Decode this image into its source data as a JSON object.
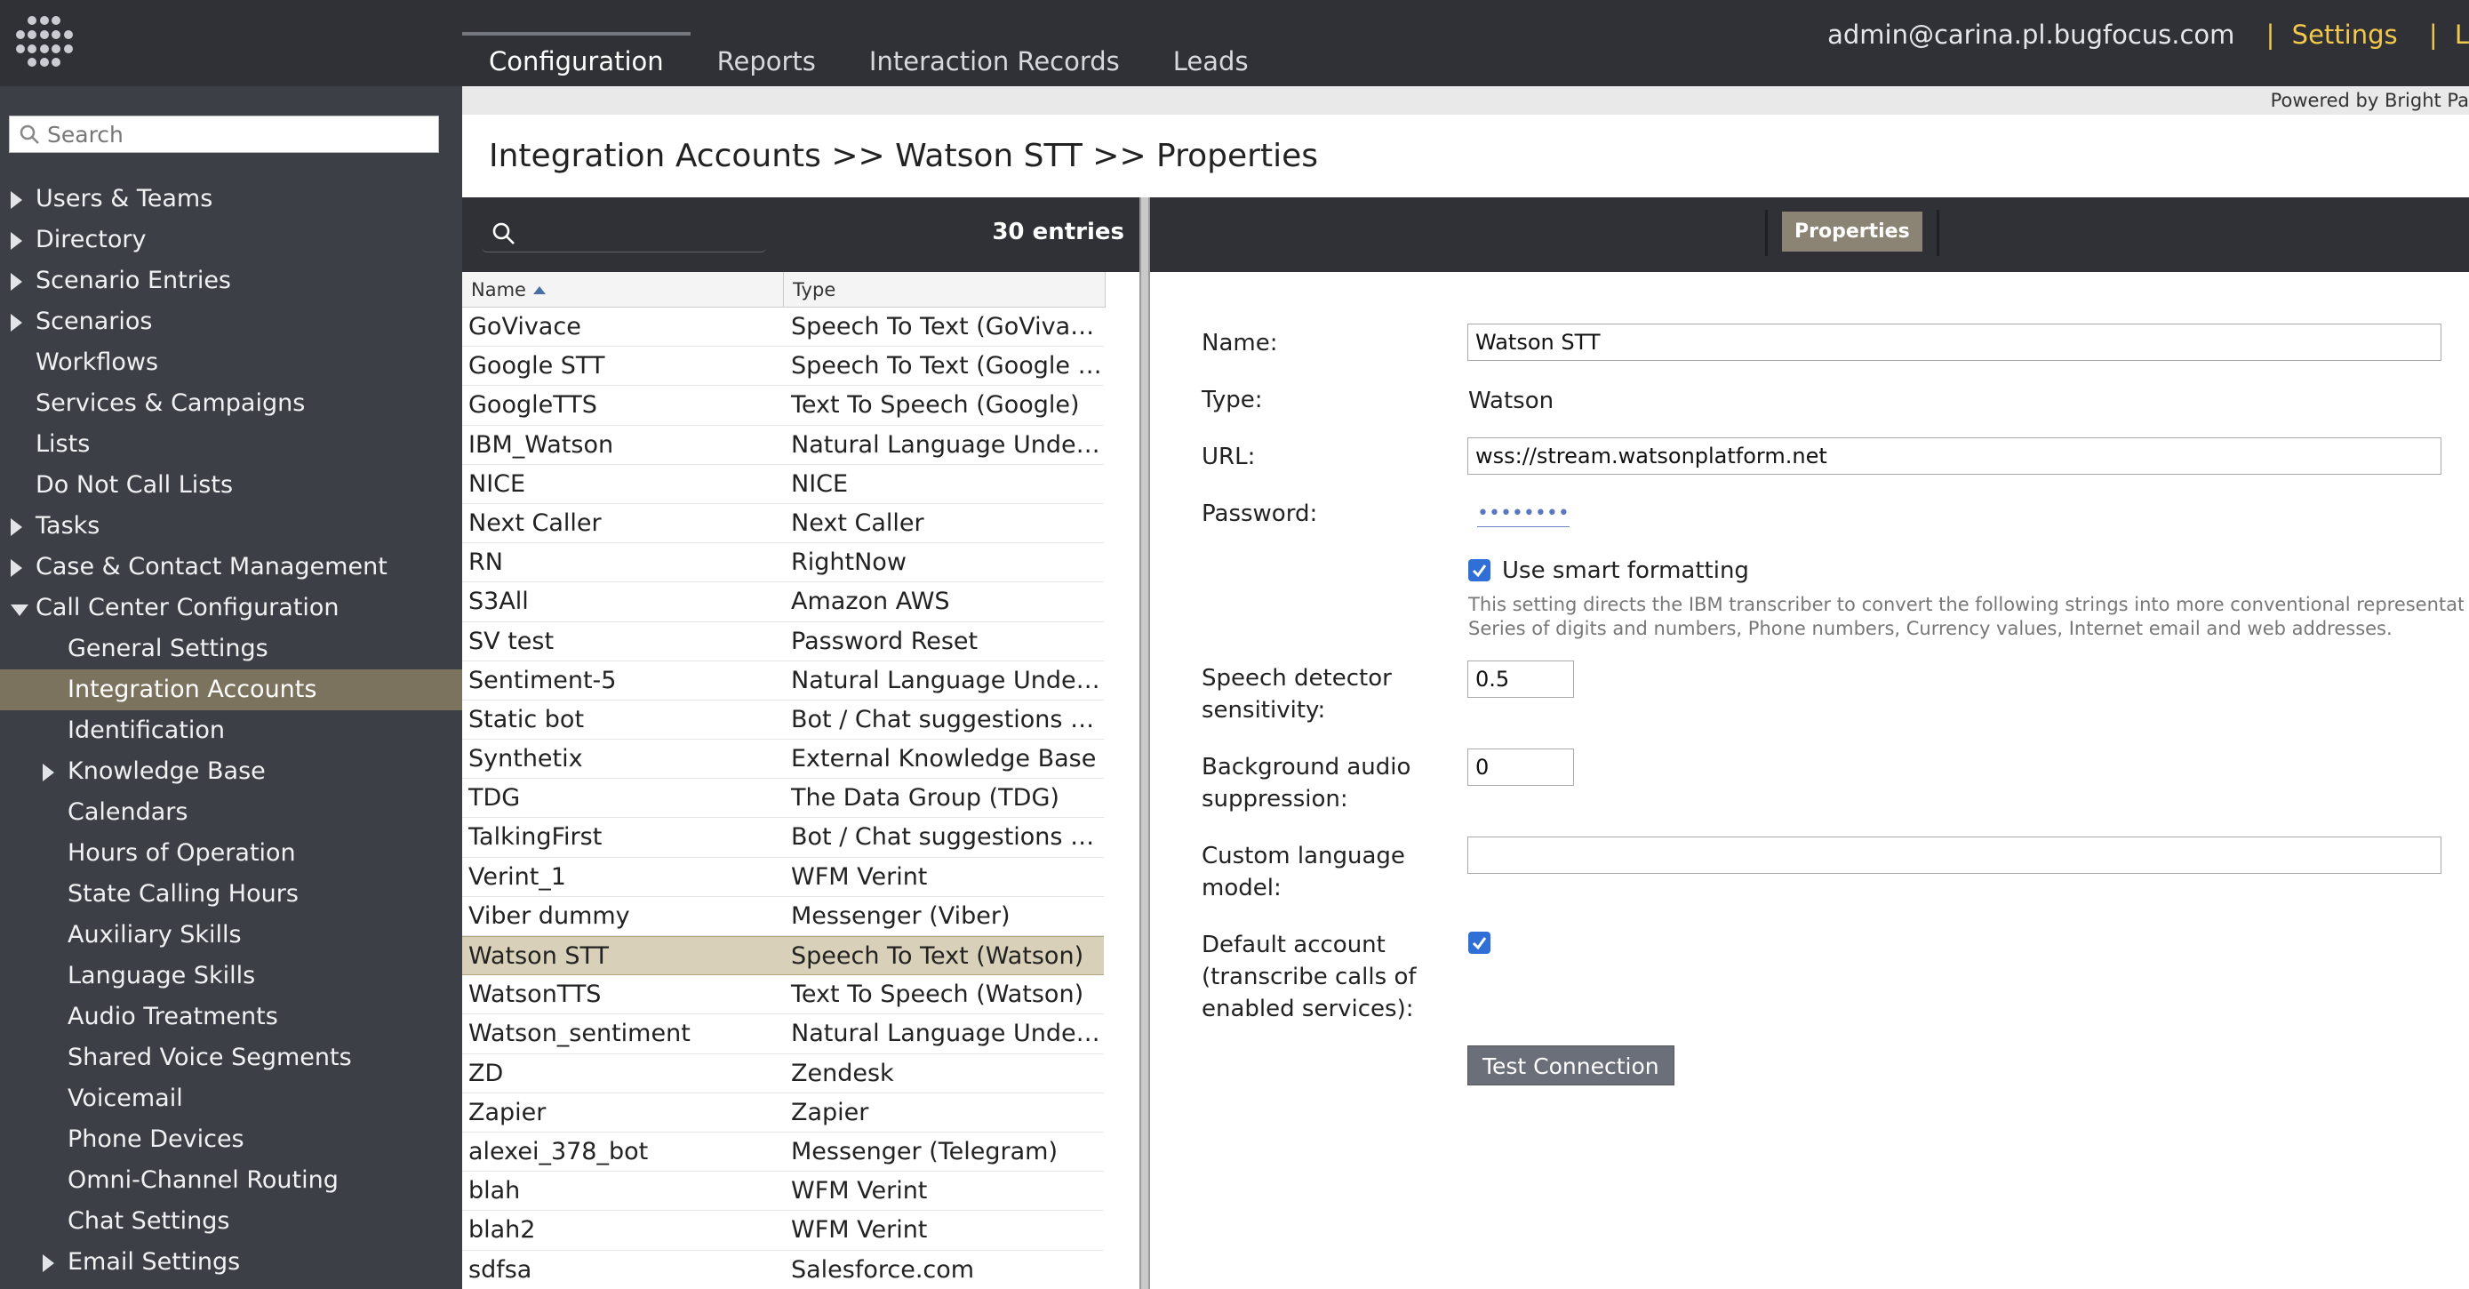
{
  "header": {
    "tabs": [
      {
        "label": "Configuration"
      },
      {
        "label": "Reports"
      },
      {
        "label": "Interaction Records"
      },
      {
        "label": "Leads"
      }
    ],
    "user_email": "admin@carina.pl.bugfocus.com",
    "separator": "|",
    "settings_label": "Settings",
    "truncated_link": "L",
    "powered_by": "Powered by Bright Pa"
  },
  "sidebar": {
    "search_placeholder": "Search",
    "items": [
      {
        "label": "Users & Teams"
      },
      {
        "label": "Directory"
      },
      {
        "label": "Scenario Entries"
      },
      {
        "label": "Scenarios"
      },
      {
        "label": "Workflows"
      },
      {
        "label": "Services & Campaigns"
      },
      {
        "label": "Lists"
      },
      {
        "label": "Do Not Call Lists"
      },
      {
        "label": "Tasks"
      },
      {
        "label": "Case & Contact Management"
      },
      {
        "label": "Call Center Configuration"
      },
      {
        "label": "General Settings"
      },
      {
        "label": "Integration Accounts"
      },
      {
        "label": "Identification"
      },
      {
        "label": "Knowledge Base"
      },
      {
        "label": "Calendars"
      },
      {
        "label": "Hours of Operation"
      },
      {
        "label": "State Calling Hours"
      },
      {
        "label": "Auxiliary Skills"
      },
      {
        "label": "Language Skills"
      },
      {
        "label": "Audio Treatments"
      },
      {
        "label": "Shared Voice Segments"
      },
      {
        "label": "Voicemail"
      },
      {
        "label": "Phone Devices"
      },
      {
        "label": "Omni-Channel Routing"
      },
      {
        "label": "Chat Settings"
      },
      {
        "label": "Email Settings"
      }
    ]
  },
  "page_title": "Integration Accounts >> Watson STT >> Properties",
  "list": {
    "entries_count": "30 entries",
    "columns": {
      "name": "Name",
      "type": "Type"
    },
    "rows": [
      {
        "name": "GoVivace",
        "type": "Speech To Text (GoVivace)"
      },
      {
        "name": "Google STT",
        "type": "Speech To Text (Google sy..."
      },
      {
        "name": "GoogleTTS",
        "type": "Text To Speech (Google)"
      },
      {
        "name": "IBM_Watson",
        "type": "Natural Language Unders..."
      },
      {
        "name": "NICE",
        "type": "NICE"
      },
      {
        "name": "Next Caller",
        "type": "Next Caller"
      },
      {
        "name": "RN",
        "type": "RightNow"
      },
      {
        "name": "S3All",
        "type": "Amazon AWS"
      },
      {
        "name": "SV test",
        "type": "Password Reset"
      },
      {
        "name": "Sentiment-5",
        "type": "Natural Language Unders..."
      },
      {
        "name": "Static bot",
        "type": "Bot / Chat suggestions en..."
      },
      {
        "name": "Synthetix",
        "type": "External Knowledge Base"
      },
      {
        "name": "TDG",
        "type": "The Data Group (TDG)"
      },
      {
        "name": "TalkingFirst",
        "type": "Bot / Chat suggestions en..."
      },
      {
        "name": "Verint_1",
        "type": "WFM Verint"
      },
      {
        "name": "Viber dummy",
        "type": "Messenger (Viber)"
      },
      {
        "name": "Watson STT",
        "type": "Speech To Text (Watson)"
      },
      {
        "name": "WatsonTTS",
        "type": "Text To Speech (Watson)"
      },
      {
        "name": "Watson_sentiment",
        "type": "Natural Language Unders..."
      },
      {
        "name": "ZD",
        "type": "Zendesk"
      },
      {
        "name": "Zapier",
        "type": "Zapier"
      },
      {
        "name": "alexei_378_bot",
        "type": "Messenger (Telegram)"
      },
      {
        "name": "blah",
        "type": "WFM Verint"
      },
      {
        "name": "blah2",
        "type": "WFM Verint"
      },
      {
        "name": "sdfsa",
        "type": "Salesforce.com"
      }
    ]
  },
  "properties": {
    "tab_label": "Properties",
    "name_label": "Name:",
    "name_value": "Watson STT",
    "type_label": "Type:",
    "type_value": "Watson",
    "url_label": "URL:",
    "url_value": "wss://stream.watsonplatform.net",
    "password_label": "Password:",
    "password_value": "••••••••",
    "smart_formatting_label": "Use smart formatting",
    "smart_formatting_help_1": "This setting directs the IBM transcriber to convert the following strings into more conventional representation",
    "smart_formatting_help_2": "Series of digits and numbers, Phone numbers, Currency values, Internet email and web addresses.",
    "speech_detector_label_1": "Speech detector",
    "speech_detector_label_2": "sensitivity:",
    "speech_detector_value": "0.5",
    "bg_audio_label_1": "Background audio",
    "bg_audio_label_2": "suppression:",
    "bg_audio_value": "0",
    "custom_lang_label_1": "Custom language",
    "custom_lang_label_2": "model:",
    "custom_lang_value": "",
    "default_account_label_1": "Default account",
    "default_account_label_2": "(transcribe calls of",
    "default_account_label_3": "enabled services):",
    "test_button_label": "Test Connection"
  },
  "colors": {
    "topbar": "#2f3136",
    "sidebar": "#3c3f45",
    "accent_yellow": "#f2c94c",
    "selected_row": "#d8d0b8",
    "checkbox": "#2f6fd6"
  }
}
